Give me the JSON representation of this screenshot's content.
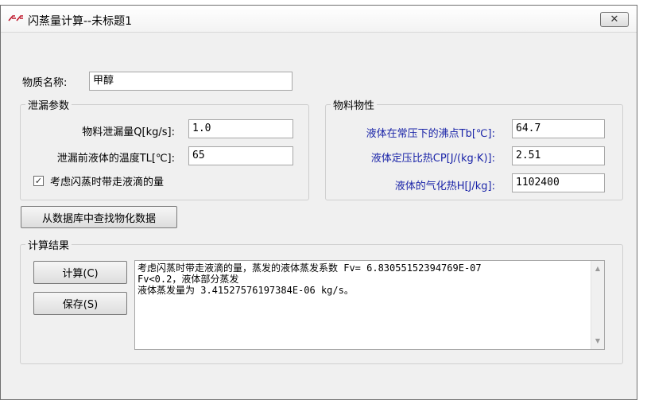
{
  "window": {
    "title": "闪蒸量计算--未标题1",
    "close_glyph": "✕"
  },
  "substance": {
    "label": "物质名称:",
    "value": "甲醇"
  },
  "leak_params": {
    "title": "泄漏参数",
    "rate_label": "物料泄漏量Q[kg/s]:",
    "rate_value": "1.0",
    "temp_label": "泄漏前液体的温度TL[℃]:",
    "temp_value": "65",
    "droplet_checkbox_label": "考虑闪蒸时带走液滴的量",
    "droplet_checked": true,
    "check_glyph": "✓"
  },
  "properties": {
    "title": "物料物性",
    "boiling_label": "液体在常压下的沸点Tb[℃]:",
    "boiling_value": "64.7",
    "cp_label": "液体定压比热CP[J/(kg·K)]:",
    "cp_value": "2.51",
    "vap_label": "液体的气化热H[J/kg]:",
    "vap_value": "1102400"
  },
  "lookup_button": "从数据库中查找物化数据",
  "results": {
    "title": "计算结果",
    "calc_button": "计算(C)",
    "save_button": "保存(S)",
    "lines": [
      "考虑闪蒸时带走液滴的量，蒸发的液体蒸发系数 Fv= 6.83055152394769E-07",
      "Fv<0.2，液体部分蒸发",
      "液体蒸发量为 3.41527576197384E-06 kg/s。"
    ],
    "scroll_up": "▲",
    "scroll_down": "▼"
  },
  "colors": {
    "window_bg": "#f0f0f0",
    "blue_label": "#1a24a8"
  }
}
